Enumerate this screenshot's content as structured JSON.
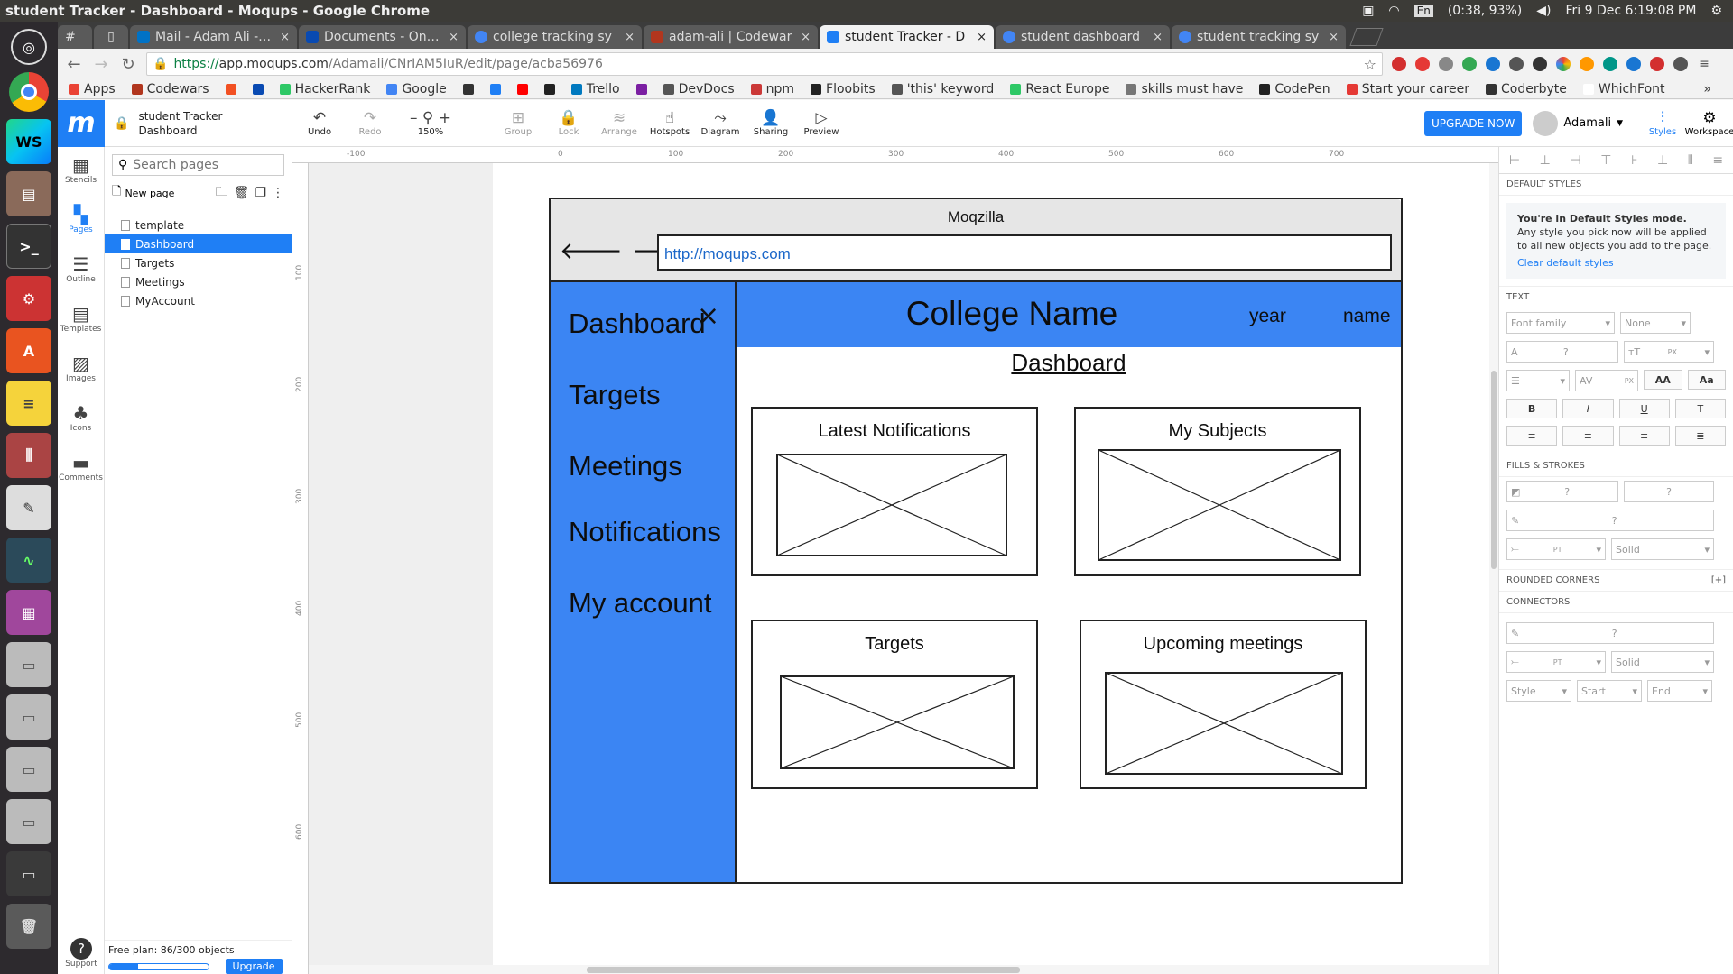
{
  "system": {
    "window_title": "student Tracker - Dashboard - Moqups - Google Chrome",
    "keyboard": "En",
    "battery": "(0:38, 93%)",
    "clock": "Fri 9 Dec 6:19:08 PM"
  },
  "browser": {
    "tabs": [
      {
        "label": "#",
        "color": "#555555"
      },
      {
        "label": "Mail - Adam Ali - Ou",
        "color": "#0072c6"
      },
      {
        "label": "Documents - OneD",
        "color": "#094ab2"
      },
      {
        "label": "college tracking sy",
        "color": "#4285f4"
      },
      {
        "label": "adam-ali | Codewar",
        "color": "#b1361e"
      },
      {
        "label": "student Tracker - D",
        "color": "#1f7ff5"
      },
      {
        "label": "student dashboard",
        "color": "#4285f4"
      },
      {
        "label": "student tracking sy",
        "color": "#4285f4"
      }
    ],
    "url_scheme": "https://",
    "url_host": "app.moqups.com",
    "url_path": "/Adamali/CNrIAM5IuR/edit/page/acba56976",
    "bookmarks": [
      {
        "label": "Apps",
        "color": "#ea4335"
      },
      {
        "label": "Codewars",
        "color": "#b1361e"
      },
      {
        "label": "",
        "color": "#f25022"
      },
      {
        "label": "",
        "color": "#094ab2"
      },
      {
        "label": "HackerRank",
        "color": "#2ec866"
      },
      {
        "label": "Google",
        "color": "#4285f4"
      },
      {
        "label": "",
        "color": "#333333"
      },
      {
        "label": "",
        "color": "#1f7ff5"
      },
      {
        "label": "",
        "color": "#ff0000"
      },
      {
        "label": "",
        "color": "#222222"
      },
      {
        "label": "Trello",
        "color": "#0079bf"
      },
      {
        "label": "",
        "color": "#7b1fa2"
      },
      {
        "label": "DevDocs",
        "color": "#555555"
      },
      {
        "label": "npm",
        "color": "#cb3837"
      },
      {
        "label": "Floobits",
        "color": "#222222"
      },
      {
        "label": "'this' keyword",
        "color": "#555555"
      },
      {
        "label": "React Europe",
        "color": "#2ec866"
      },
      {
        "label": "skills must have",
        "color": "#777777"
      },
      {
        "label": "CodePen",
        "color": "#222222"
      },
      {
        "label": "Start your career",
        "color": "#e53935"
      },
      {
        "label": "Coderbyte",
        "color": "#333333"
      },
      {
        "label": "WhichFont",
        "color": "#ffffff"
      }
    ],
    "more_bookmarks": "»"
  },
  "moqups": {
    "project_line1": "student Tracker",
    "project_line2": "Dashboard",
    "toolbar": {
      "undo": "Undo",
      "redo": "Redo",
      "zoom": "150%",
      "group": "Group",
      "lock": "Lock",
      "arrange": "Arrange",
      "hotspots": "Hotspots",
      "diagram": "Diagram",
      "sharing": "Sharing",
      "preview": "Preview",
      "upgrade_now": "UPGRADE NOW",
      "user": "Adamali",
      "styles": "Styles",
      "workspace": "Workspace"
    },
    "leftbar": {
      "stencils": "Stencils",
      "pages": "Pages",
      "outline": "Outline",
      "templates": "Templates",
      "images": "Images",
      "icons": "Icons",
      "comments": "Comments",
      "support": "Support"
    },
    "pages_panel": {
      "search_placeholder": "Search pages",
      "new_page": "New page",
      "pages": [
        "template",
        "Dashboard",
        "Targets",
        "Meetings",
        "MyAccount"
      ],
      "selected_page": "Dashboard",
      "free_plan": "Free plan: 86/300 objects",
      "free_plan_fraction": 0.2867,
      "upgrade": "Upgrade"
    },
    "rulers": {
      "horizontal": [
        "-100",
        "0",
        "100",
        "200",
        "300",
        "400",
        "500",
        "600",
        "700"
      ],
      "vertical": [
        "100",
        "200",
        "300",
        "400",
        "500",
        "600"
      ]
    },
    "right_panel": {
      "default_styles": "DEFAULT STYLES",
      "default_mode_title": "You're in Default Styles mode.",
      "default_mode_text": "Any style you pick now will be applied to all new objects you add to the page.",
      "clear_default": "Clear default styles",
      "text_section": "TEXT",
      "font_family": "Font family",
      "none": "None",
      "q": "?",
      "px": "PX",
      "pt": "PT",
      "aa_upper": "AA",
      "aa_mixed": "Aa",
      "bold": "B",
      "italic": "I",
      "underline": "U",
      "strike": "T",
      "fills_strokes": "FILLS & STROKES",
      "solid": "Solid",
      "rounded_corners": "ROUNDED CORNERS",
      "rounded_plus": "[+]",
      "connectors": "CONNECTORS",
      "style": "Style",
      "start": "Start",
      "end": "End"
    }
  },
  "wireframe": {
    "browser_title": "Moqzilla",
    "url": "http://moqups.com",
    "close": "×",
    "nav": [
      "Dashboard",
      "Targets",
      "Meetings",
      "Notifications",
      "My account"
    ],
    "college_name": "College Name",
    "year": "year",
    "name": "name",
    "page_heading": "Dashboard",
    "cards": [
      "Latest Notifications",
      "My Subjects",
      "Targets",
      "Upcoming meetings"
    ],
    "accent_color": "#3b85f3"
  }
}
